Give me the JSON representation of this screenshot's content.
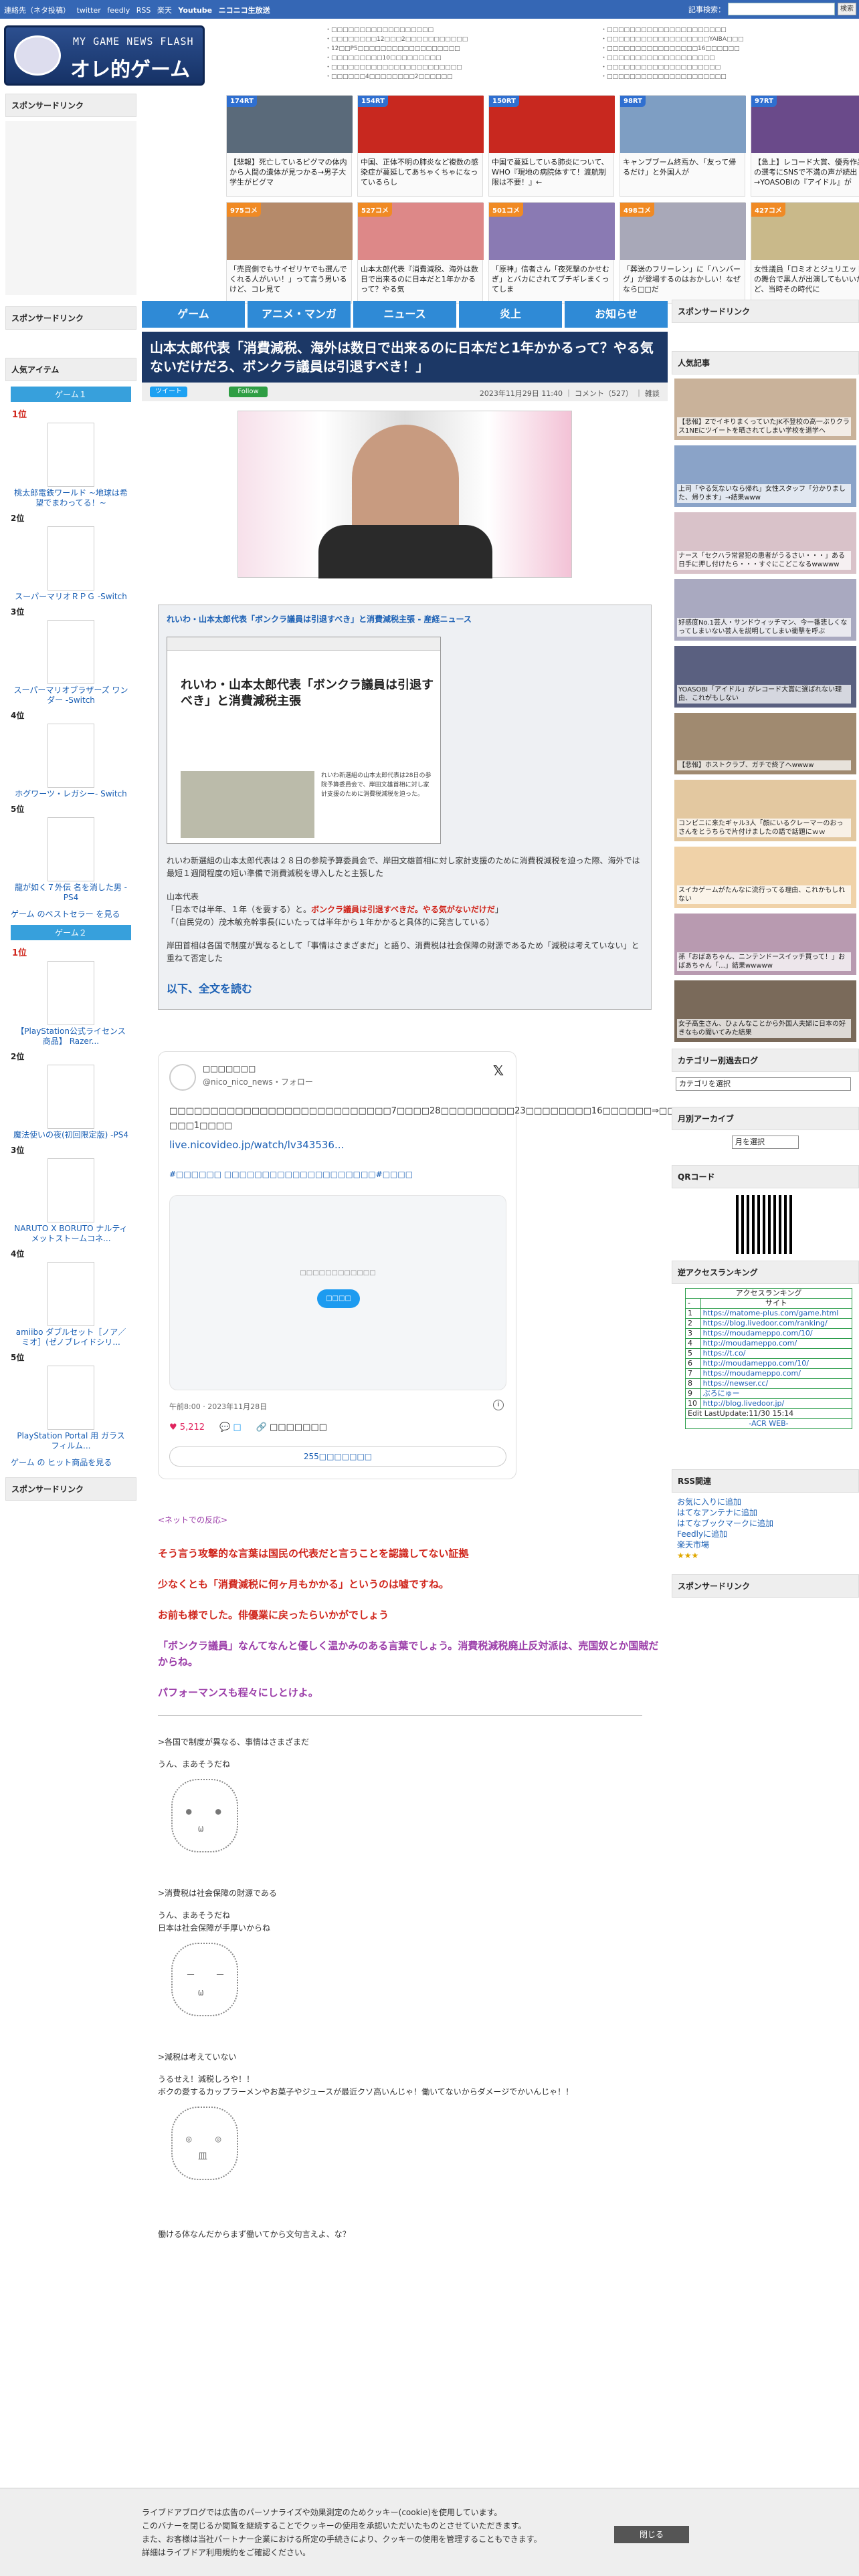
{
  "topbar": {
    "links": [
      "連絡先（ネタ投稿）",
      "twitter",
      "feedly",
      "RSS",
      "楽天",
      "Youtube",
      "ニコニコ生放送"
    ],
    "search_label": "記事検索：",
    "search_button": "検索"
  },
  "logo": {
    "sub": "MY GAME NEWS FLASH",
    "main": "オレ的ゲーム速報@JIN"
  },
  "header_list_left": [
    "・□□□□□□□□□□□□□□□□□□",
    "・□□□□□□□□12□□□2□□□□□□□□□□□",
    "・12□□P5□□□□□□□□□□□□□□□□□□",
    "・□□□□□□□□□10□□□□□□□□□",
    "・□□□□□□□□□□□□□□□□□□□□□□□",
    "・□□□□□□4□□□□□□□□2□□□□□□"
  ],
  "header_list_right": [
    "・□□□□□□□□□□□□□□□□□□□□□",
    "・□□□□□□□□□□□□□□□□□□YAIBA□□□",
    "・□□□□□□□□□□□□□□□□16□□□□□□",
    "・□□□□□□□□□□□□□□□□□□□",
    "・□□□□□□□□□□□□□□□□□□□□",
    "・□□□□□□□□□□□□□□□□□□□□□"
  ],
  "sponsor_label": "スポンサードリンク",
  "thumbs": [
    {
      "badge": "174RT",
      "cap": "【悲報】死亡しているビグマの体内から人間の遺体が見つかる→男子大学生がビグマ",
      "color": "#5a6a7a"
    },
    {
      "badge": "154RT",
      "cap": "中国、正体不明の肺炎など複数の感染症が蔓延してあちゃくちゃになっているらし",
      "color": "#c8281f"
    },
    {
      "badge": "150RT",
      "cap": "中国で蔓延している肺炎について、WHO『現地の病院体すて！渡航制限は不要！』←",
      "color": "#c8281f"
    },
    {
      "badge": "98RT",
      "cap": "キャンプブーム終焉か、「友って帰るだけ」と外国人が",
      "color": "#7e9ec3"
    },
    {
      "badge": "97RT",
      "cap": "【急上】レコード大賞、優秀作品賞の選考にSNSで不満の声が続出→YOASOBIの『アイドル』が",
      "color": "#6a4a8a"
    },
    {
      "badge": "975コメ",
      "cap": "「売買側でもサイゼリヤでも選んでくれる人がいい！」って言う男いるけど、コレ見て",
      "color": "#b58a6a",
      "or": true
    },
    {
      "badge": "527コメ",
      "cap": "山本太郎代表『消費減税、海外は数日で出来るのに日本だと1年かかるって？やる気",
      "color": "#d88",
      "or": true
    },
    {
      "badge": "501コメ",
      "cap": "「原神」信者さん「夜死撃のかせむぎ」とバカにされてブチギレまくってしま",
      "color": "#8a7ab3",
      "or": true
    },
    {
      "badge": "498コメ",
      "cap": "「葬送のフリーレン」に「ハンバーグ」が登場するのはおかしい！なぜなら□□だ",
      "color": "#a8a8b8",
      "or": true
    },
    {
      "badge": "427コメ",
      "cap": "女性議員「ロミオとジュリエット」の舞台で黒人が出演してもいいだけど、当時その時代に",
      "color": "#c9b98a",
      "or": true
    }
  ],
  "nav": [
    "ゲーム",
    "アニメ・マンガ",
    "ニュース",
    "炎上",
    "お知らせ"
  ],
  "left": {
    "sponsor": "スポンサードリンク",
    "popular": "人気アイテム",
    "game1": "ゲーム１",
    "game2": "ゲーム２",
    "ranks1": [
      {
        "rank": "1位",
        "name": "桃太郎電鉄ワールド ~地球は希望でまわってる！~"
      },
      {
        "rank": "2位",
        "name": "スーパーマリオＲＰＧ -Switch"
      },
      {
        "rank": "3位",
        "name": "スーパーマリオブラザーズ ワンダー -Switch"
      },
      {
        "rank": "4位",
        "name": "ホグワーツ・レガシー- Switch"
      },
      {
        "rank": "5位",
        "name": "龍が如く７外伝 名を消した男 - PS4"
      }
    ],
    "more1": "ゲーム のベストセラー を見る",
    "ranks2": [
      {
        "rank": "1位",
        "name": "【PlayStation公式ライセンス商品】 Razer..."
      },
      {
        "rank": "2位",
        "name": "魔法使いの夜(初回限定版) -PS4"
      },
      {
        "rank": "3位",
        "name": "NARUTO X BORUTO ナルティメットストームコネ..."
      },
      {
        "rank": "4位",
        "name": "amiibo ダブルセット［ノア／ミオ］(ゼノブレイドシリ..."
      },
      {
        "rank": "5位",
        "name": "PlayStation Portal 用 ガラスフィルム..."
      }
    ],
    "more2": "ゲーム の ヒット商品を見る",
    "sponsor2": "スポンサードリンク"
  },
  "article": {
    "title": "山本太郎代表「消費減税、海外は数日で出来るのに日本だと1年かかるって？やる気ないだけだろ、ボンクラ議員は引退すべき！」",
    "tweet_btn": "ツイート",
    "follow_btn": "Follow",
    "date": "2023年11月29日 11:40 ｜ コメント（527） ｜ 雑談",
    "quote_head": "れいわ・山本太郎代表「ボンクラ議員は引退すべき」と消費減税主張 - 産経ニュース",
    "shot_title": "れいわ・山本太郎代表「ボンクラ議員は引退すべき」と消費減税主張",
    "shot_text": "れいわ新選組の山本太郎代表は28日の参院予算委員会で、岸田文雄首相に対し家計支援のために消費税減税を迫った。",
    "p1": "れいわ新選組の山本太郎代表は２８日の参院予算委員会で、岸田文雄首相に対し家計支援のために消費税減税を迫った際、海外では最短１週間程度の短い準備で消費減税を導入したと主張した",
    "p2a": "山本代表",
    "p2b": "「日本では半年、１年（を要する）と。",
    "p2red": "ボンクラ議員は引退すべきだ。やる気がないだけだ",
    "p2c": "」",
    "p2d": "「（自民党の）茂木敏充幹事長(にいたっては半年から１年かかると具体的に発言している）",
    "p3": "岸田首相は各国で制度が異なるとして「事情はさまざまだ」と語り、消費税は社会保障の財源であるため「減税は考えていない」と重ねて否定した",
    "readall": "以下、全文を読む"
  },
  "tweet": {
    "name": "□□□□□□□",
    "handle": "@nico_nico_news・フォロー",
    "text": "□□□□□□□□□□□□□□□□□□□□□□□□□□□7□□□□28□□□□□□□□□23□□□□□□□□16□□□□□□⇒□□□□□□□□□□□□□□□□□□□□□……□□□1□□□□",
    "link": "live.nicovideo.jp/watch/lv343536...",
    "tag": "#□□□□□□ □□□□□□□□□□□□□□□□□□□□#□□□□",
    "card_text": "□□□□□□□□□□□□",
    "card_btn": "□□□□",
    "time": "午前8:00 · 2023年11月28日",
    "likes": "5,212",
    "reply": "□",
    "copy": "□□□□□□□",
    "replies": "255□□□□□□□"
  },
  "net": {
    "head": "<ネットでの反応>",
    "lines": [
      {
        "t": "そう言う攻撃的な言葉は国民の代表だと言うことを認識してない証拠",
        "c": "r"
      },
      {
        "t": "少なくとも「消費減税に何ヶ月もかかる」というのは嘘ですね。",
        "c": "r"
      },
      {
        "t": "お前も様でした。俳優業に戻ったらいかがでしょう",
        "c": "p"
      },
      {
        "t": "「ボンクラ議員」なんてなんと優しく温かみのある言葉でしょう。消費税減税廃止反対派は、売国奴とか国賊だからね。",
        "c": "p"
      },
      {
        "t": "パフォーマンスも程々にしとけよ。",
        "c": "p"
      }
    ]
  },
  "comments": [
    {
      "q": ">各国で制度が異なる、事情はさまざまだ",
      "a": "うん、まあそうだね"
    },
    {
      "q": ">消費税は社会保障の財源である",
      "a": "うん、まあそうだね\n日本は社会保障が手厚いからね"
    },
    {
      "q": ">減税は考えていない",
      "a": "うるせえ！減税しろや！！\nボクの愛するカップラーメンやお菓子やジュースが最近クソ高いんじゃ！働いてないからダメージでかいんじゃ！！"
    },
    {
      "q": "働ける体なんだからまず働いてから文句言えよ、な？",
      "a": ""
    }
  ],
  "right": {
    "sponsor": "スポンサードリンク",
    "popular": "人気記事",
    "articles": [
      "【悲報】ZでイキりまくっていたJK不登校の高一ぶりクラス1NEにツイートを晒されてしまい学校を退学へ",
      "上司「やる気ないなら帰れ」女性スタッフ「分かりました、帰ります」→結果www",
      "ナース「セクハラ常習犯の患者がうるさい・・・」ある日手に押し付けたら・・・すぐにこどこなるwwwww",
      "好感度No.1芸人・サンドウィッチマン、今一番悲しくなってしまいない芸人を説明してしまい衝撃を呼ぶ",
      "YOASOBI「アイドル」がレコード大賞に選ばれない理由、これがもしない",
      "【悲報】ホストクラブ、ガチで終了へwwww",
      "コンビニに来たギャル3人「顔にいるクレーマーのおっさんをとうちらで片付けましたの語で話題にｗｗ",
      "スイカゲームがたんなに流行ってる理由、これかもしれない",
      "孫「おばあちゃん、ニンテンドースイッチ買って！」おばあちゃん「…」結果wwwww",
      "女子高生さん、ひょんなことから外国人夫婦に日本の好きなもの聞いてみた結果"
    ],
    "category": "カテゴリー別過去ログ",
    "category_select": "カテゴリを選択",
    "archive": "月別アーカイブ",
    "archive_select": "月を選択",
    "qr": "QRコード",
    "ranking": "逆アクセスランキング",
    "acr_title": "アクセスランキング",
    "acr_site": "サイト",
    "acr": [
      "https://matome-plus.com/game.html",
      "https://blog.livedoor.com/ranking/",
      "https://moudameppo.com/10/",
      "http://moudameppo.com/",
      "https://t.co/",
      "http://moudameppo.com/10/",
      "https://moudameppo.com/",
      "https://newser.cc/",
      "ぶろにゅー",
      "http://blog.livedoor.jp/"
    ],
    "acr_update": "Edit LastUpdate:11/30 15:14",
    "acr_foot": "-ACR WEB-",
    "rss": "RSS関連",
    "rss_links": [
      "お気に入りに追加",
      "はてなアンテナに追加",
      "はてなブックマークに追加",
      "Feedlyに追加",
      "楽天市場"
    ],
    "sponsor2": "スポンサードリンク"
  },
  "cookie": {
    "text": "ライブドアブログでは広告のパーソナライズや効果測定のためクッキー(cookie)を使用しています。\nこのバナーを閉じるか閲覧を継続することでクッキーの使用を承認いただいたものとさせていただきます。\nまた、お客様は当社パートナー企業における所定の手続きにより、クッキーの使用を管理することもできます。\n詳細はライブドア利用規約をご確認ください。",
    "close": "閉じる"
  }
}
